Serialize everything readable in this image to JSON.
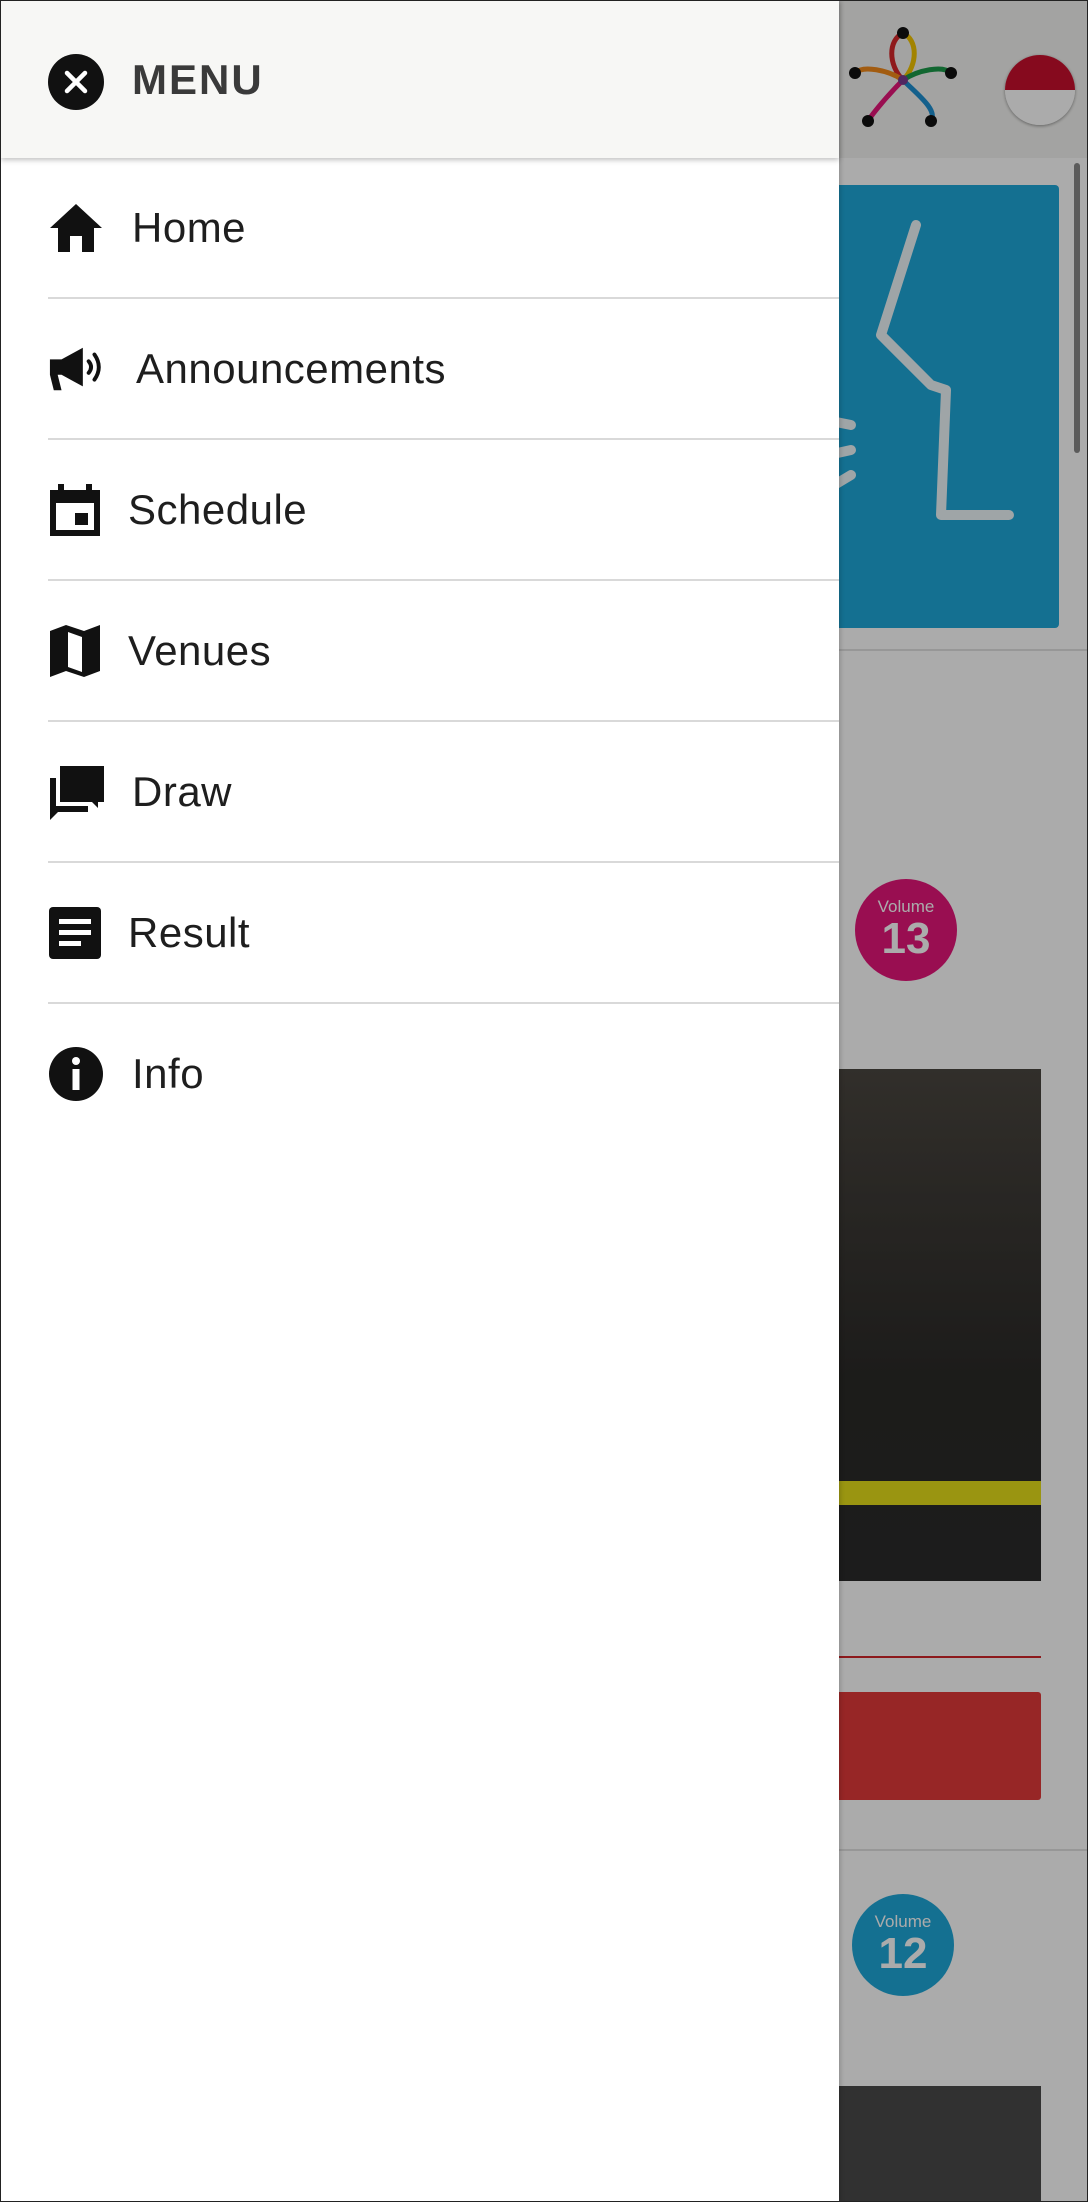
{
  "drawer": {
    "title": "MENU",
    "close_icon": "close-icon",
    "items": [
      {
        "label": "Home",
        "icon": "home-icon"
      },
      {
        "label": "Announcements",
        "icon": "megaphone-icon"
      },
      {
        "label": "Schedule",
        "icon": "calendar-icon"
      },
      {
        "label": "Venues",
        "icon": "map-icon"
      },
      {
        "label": "Draw",
        "icon": "chat-bubbles-icon"
      },
      {
        "label": "Result",
        "icon": "document-icon"
      },
      {
        "label": "Info",
        "icon": "info-icon"
      }
    ]
  },
  "background": {
    "volume_label_1": "Volume",
    "volume_number_1": "13",
    "volume_label_2": "Volume",
    "volume_number_2": "12",
    "flag_colors": [
      "#c8102e",
      "#ffffff"
    ],
    "volume_13_color": "#e5157a",
    "volume_12_color": "#1fa7d8"
  }
}
